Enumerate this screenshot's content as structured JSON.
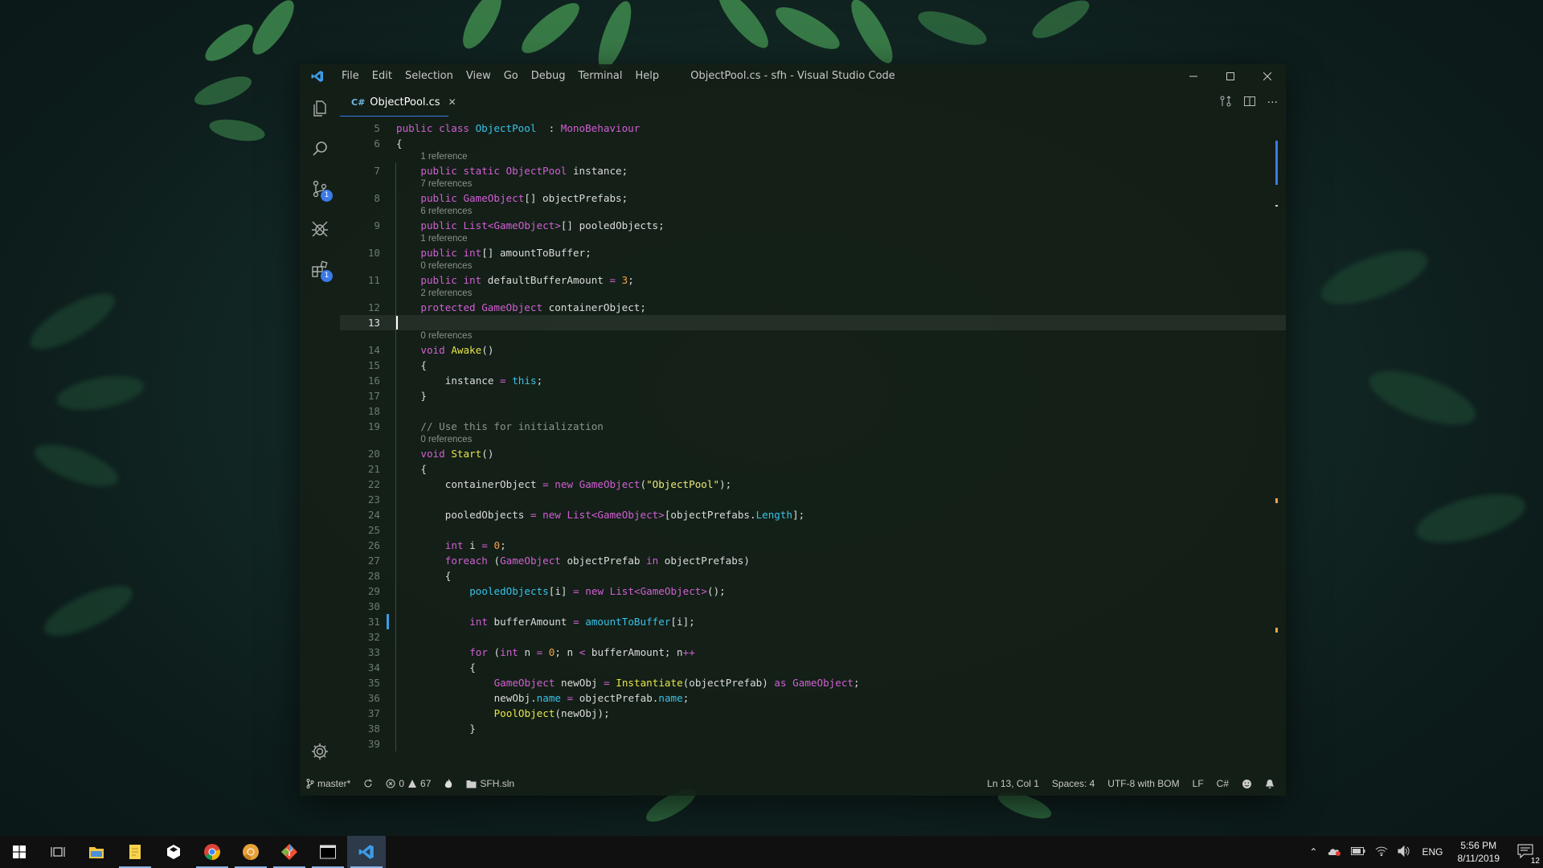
{
  "window": {
    "title": "ObjectPool.cs - sfh - Visual Studio Code",
    "menu": [
      "File",
      "Edit",
      "Selection",
      "View",
      "Go",
      "Debug",
      "Terminal",
      "Help"
    ]
  },
  "activity_bar": {
    "items": [
      {
        "name": "explorer",
        "icon": "files-icon"
      },
      {
        "name": "search",
        "icon": "search-icon"
      },
      {
        "name": "source-control",
        "icon": "source-control-icon",
        "badge": "1"
      },
      {
        "name": "debug",
        "icon": "bug-icon"
      },
      {
        "name": "extensions",
        "icon": "extensions-icon",
        "badge": "1"
      }
    ],
    "settings_icon": "gear-icon"
  },
  "tab": {
    "label": "ObjectPool.cs",
    "icon": "csharp-icon"
  },
  "editor": {
    "current_line": 13,
    "lines": [
      {
        "n": 5,
        "lens": null,
        "indent": 0,
        "tokens": [
          [
            "kw",
            "public class "
          ],
          [
            "cl",
            "ObjectPool"
          ],
          [
            "",
            "  : "
          ],
          [
            "ty",
            "MonoBehaviour"
          ]
        ]
      },
      {
        "n": 6,
        "lens": null,
        "indent": 0,
        "tokens": [
          [
            "",
            "{"
          ]
        ]
      },
      {
        "n": 7,
        "lens": "1 reference",
        "indent": 1,
        "tokens": [
          [
            "kw",
            "public static "
          ],
          [
            "ty",
            "ObjectPool"
          ],
          [
            "",
            " instance;"
          ]
        ]
      },
      {
        "n": 8,
        "lens": "7 references",
        "indent": 1,
        "tokens": [
          [
            "kw",
            "public "
          ],
          [
            "ty",
            "GameObject"
          ],
          [
            "",
            "[] objectPrefabs;"
          ]
        ]
      },
      {
        "n": 9,
        "lens": "6 references",
        "indent": 1,
        "tokens": [
          [
            "kw",
            "public "
          ],
          [
            "ty",
            "List"
          ],
          [
            "op",
            "<"
          ],
          [
            "ty",
            "GameObject"
          ],
          [
            "op",
            ">"
          ],
          [
            "",
            "[] pooledObjects;"
          ]
        ]
      },
      {
        "n": 10,
        "lens": "1 reference",
        "indent": 1,
        "tokens": [
          [
            "kw",
            "public "
          ],
          [
            "ty",
            "int"
          ],
          [
            "",
            "[] amountToBuffer;"
          ]
        ]
      },
      {
        "n": 11,
        "lens": "0 references",
        "indent": 1,
        "tokens": [
          [
            "kw",
            "public "
          ],
          [
            "ty",
            "int"
          ],
          [
            "",
            " defaultBufferAmount "
          ],
          [
            "op",
            "="
          ],
          [
            "nu",
            " 3"
          ],
          [
            "",
            ";"
          ]
        ]
      },
      {
        "n": 12,
        "lens": "2 references",
        "indent": 1,
        "tokens": [
          [
            "kw",
            "protected "
          ],
          [
            "ty",
            "GameObject"
          ],
          [
            "",
            " containerObject;"
          ]
        ]
      },
      {
        "n": 13,
        "lens": null,
        "indent": 0,
        "tokens": []
      },
      {
        "n": 14,
        "lens": "0 references",
        "indent": 1,
        "tokens": [
          [
            "kw",
            "void "
          ],
          [
            "fn",
            "Awake"
          ],
          [
            "",
            "()"
          ]
        ]
      },
      {
        "n": 15,
        "lens": null,
        "indent": 1,
        "tokens": [
          [
            "",
            "{"
          ]
        ]
      },
      {
        "n": 16,
        "lens": null,
        "indent": 2,
        "tokens": [
          [
            "",
            "instance "
          ],
          [
            "op",
            "="
          ],
          [
            "cl",
            " this"
          ],
          [
            "",
            ";"
          ]
        ]
      },
      {
        "n": 17,
        "lens": null,
        "indent": 1,
        "tokens": [
          [
            "",
            "}"
          ]
        ]
      },
      {
        "n": 18,
        "lens": null,
        "indent": 0,
        "tokens": []
      },
      {
        "n": 19,
        "lens": null,
        "indent": 1,
        "tokens": [
          [
            "cm",
            "// Use this for initialization"
          ]
        ]
      },
      {
        "n": 20,
        "lens": "0 references",
        "indent": 1,
        "tokens": [
          [
            "kw",
            "void "
          ],
          [
            "fn",
            "Start"
          ],
          [
            "",
            "()"
          ]
        ]
      },
      {
        "n": 21,
        "lens": null,
        "indent": 1,
        "tokens": [
          [
            "",
            "{"
          ]
        ]
      },
      {
        "n": 22,
        "lens": null,
        "indent": 2,
        "tokens": [
          [
            "",
            "containerObject "
          ],
          [
            "op",
            "="
          ],
          [
            "kw",
            " new "
          ],
          [
            "ty",
            "GameObject"
          ],
          [
            "",
            "("
          ],
          [
            "st",
            "\"ObjectPool\""
          ],
          [
            "",
            ");"
          ]
        ]
      },
      {
        "n": 23,
        "lens": null,
        "indent": 0,
        "tokens": []
      },
      {
        "n": 24,
        "lens": null,
        "indent": 2,
        "tokens": [
          [
            "",
            "pooledObjects "
          ],
          [
            "op",
            "="
          ],
          [
            "kw",
            " new "
          ],
          [
            "ty",
            "List"
          ],
          [
            "op",
            "<"
          ],
          [
            "ty",
            "GameObject"
          ],
          [
            "op",
            ">"
          ],
          [
            "",
            "[objectPrefabs."
          ],
          [
            "pr",
            "Length"
          ],
          [
            "",
            "];"
          ]
        ]
      },
      {
        "n": 25,
        "lens": null,
        "indent": 0,
        "tokens": []
      },
      {
        "n": 26,
        "lens": null,
        "indent": 2,
        "tokens": [
          [
            "ty",
            "int"
          ],
          [
            "",
            " i "
          ],
          [
            "op",
            "="
          ],
          [
            "nu",
            " 0"
          ],
          [
            "",
            ";"
          ]
        ]
      },
      {
        "n": 27,
        "lens": null,
        "indent": 2,
        "tokens": [
          [
            "kw",
            "foreach "
          ],
          [
            "",
            "("
          ],
          [
            "ty",
            "GameObject"
          ],
          [
            "",
            " objectPrefab "
          ],
          [
            "kw",
            "in"
          ],
          [
            "",
            " objectPrefabs)"
          ]
        ]
      },
      {
        "n": 28,
        "lens": null,
        "indent": 2,
        "tokens": [
          [
            "",
            "{"
          ]
        ]
      },
      {
        "n": 29,
        "lens": null,
        "indent": 3,
        "tokens": [
          [
            "cl",
            "pooledObjects"
          ],
          [
            "",
            "[i] "
          ],
          [
            "op",
            "="
          ],
          [
            "kw",
            " new "
          ],
          [
            "ty",
            "List"
          ],
          [
            "op",
            "<"
          ],
          [
            "ty",
            "GameObject"
          ],
          [
            "op",
            ">"
          ],
          [
            "",
            "();"
          ]
        ]
      },
      {
        "n": 30,
        "lens": null,
        "indent": 0,
        "tokens": []
      },
      {
        "n": 31,
        "lens": null,
        "indent": 3,
        "tokens": [
          [
            "ty",
            "int"
          ],
          [
            "",
            " bufferAmount "
          ],
          [
            "op",
            "="
          ],
          [
            "cl",
            " amountToBuffer"
          ],
          [
            "",
            "[i];"
          ]
        ]
      },
      {
        "n": 32,
        "lens": null,
        "indent": 0,
        "tokens": []
      },
      {
        "n": 33,
        "lens": null,
        "indent": 3,
        "tokens": [
          [
            "kw",
            "for "
          ],
          [
            "",
            "("
          ],
          [
            "ty",
            "int"
          ],
          [
            "",
            " n "
          ],
          [
            "op",
            "="
          ],
          [
            "nu",
            " 0"
          ],
          [
            "",
            "; n "
          ],
          [
            "op",
            "<"
          ],
          [
            "",
            " bufferAmount; n"
          ],
          [
            "op",
            "++"
          ],
          [
            ")"
          ]
        ]
      },
      {
        "n": 34,
        "lens": null,
        "indent": 3,
        "tokens": [
          [
            "",
            "{"
          ]
        ]
      },
      {
        "n": 35,
        "lens": null,
        "indent": 4,
        "tokens": [
          [
            "ty",
            "GameObject"
          ],
          [
            "",
            " newObj "
          ],
          [
            "op",
            "="
          ],
          [
            "fn",
            " Instantiate"
          ],
          [
            "",
            "(objectPrefab) "
          ],
          [
            "kw",
            "as"
          ],
          [
            "ty",
            " GameObject"
          ],
          [
            "",
            ";"
          ]
        ]
      },
      {
        "n": 36,
        "lens": null,
        "indent": 4,
        "tokens": [
          [
            "",
            "newObj."
          ],
          [
            "pr",
            "name"
          ],
          [
            "",
            " "
          ],
          [
            "op",
            "="
          ],
          [
            "",
            " objectPrefab."
          ],
          [
            "pr",
            "name"
          ],
          [
            "",
            ";"
          ]
        ]
      },
      {
        "n": 37,
        "lens": null,
        "indent": 4,
        "tokens": [
          [
            "fn",
            "PoolObject"
          ],
          [
            "",
            "(newObj);"
          ]
        ]
      },
      {
        "n": 38,
        "lens": null,
        "indent": 3,
        "tokens": [
          [
            "",
            "}"
          ]
        ]
      },
      {
        "n": 39,
        "lens": null,
        "indent": 0,
        "tokens": []
      }
    ]
  },
  "status": {
    "branch": "master*",
    "errors": "0",
    "warnings": "67",
    "solution": "SFH.sln",
    "position": "Ln 13, Col 1",
    "spaces": "Spaces: 4",
    "encoding": "UTF-8 with BOM",
    "eol": "LF",
    "language": "C#"
  },
  "taskbar": {
    "lang": "ENG",
    "time": "5:56 PM",
    "date": "8/11/2019",
    "notifications": "12",
    "apps": [
      {
        "icon": "start-icon"
      },
      {
        "icon": "task-view-icon"
      },
      {
        "icon": "file-explorer-icon"
      },
      {
        "icon": "notes-icon",
        "running": true
      },
      {
        "icon": "unity-icon"
      },
      {
        "icon": "chrome-icon",
        "running": true
      },
      {
        "icon": "chrome-canary-icon",
        "running": true
      },
      {
        "icon": "git-icon",
        "running": true
      },
      {
        "icon": "terminal-icon",
        "running": true
      },
      {
        "icon": "vscode-icon",
        "running": true,
        "active": true
      }
    ]
  },
  "colors": {
    "accent": "#3b7be8",
    "keyword": "#d25fd4",
    "class": "#3ac1e8",
    "function": "#e8e548",
    "number": "#f6a14a"
  }
}
